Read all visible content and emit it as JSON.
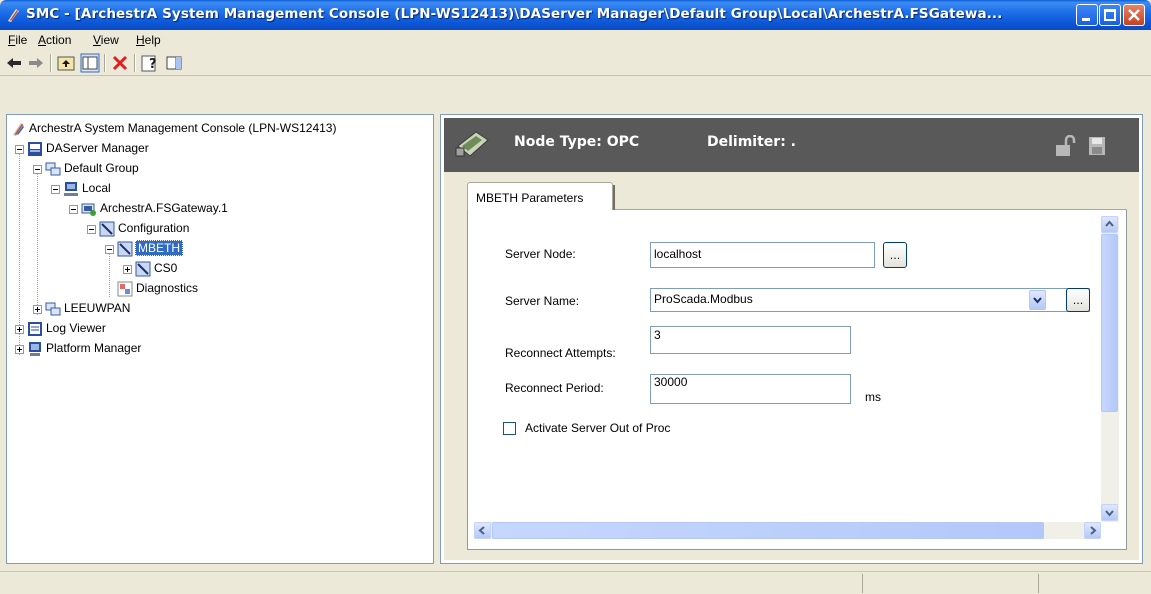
{
  "window": {
    "title": "SMC - [ArchestrA System Management Console (LPN-WS12413)\\DAServer Manager\\Default Group\\Local\\ArchestrA.FSGatewa..."
  },
  "menu": {
    "items": [
      {
        "key": "F",
        "rest": "ile"
      },
      {
        "key": "A",
        "rest": "ction"
      },
      {
        "key": "V",
        "rest": "iew"
      },
      {
        "key": "H",
        "rest": "elp"
      }
    ]
  },
  "toolbar": {
    "icons": [
      "back-arrow-icon",
      "forward-arrow-icon",
      "up-folder-icon",
      "show-hide-tree-icon",
      "delete-icon",
      "properties-icon",
      "show-hide-action-pane-icon"
    ]
  },
  "tree": {
    "root": "ArchestrA System Management Console (LPN-WS12413)",
    "daserver_manager": "DAServer Manager",
    "default_group": "Default Group",
    "local": "Local",
    "fsgateway": "ArchestrA.FSGateway.1",
    "configuration": "Configuration",
    "mbeth": "MBETH",
    "cs0": "CS0",
    "diagnostics": "Diagnostics",
    "leeuwpan": "LEEUWPAN",
    "log_viewer": "Log Viewer",
    "platform_manager": "Platform Manager"
  },
  "details": {
    "node_type": "Node Type: OPC",
    "delimiter": "Delimiter: .",
    "tab_label": "MBETH Parameters",
    "server_node": {
      "label": "Server Node:",
      "value": "localhost"
    },
    "server_name": {
      "label": "Server Name:",
      "value": "ProScada.Modbus"
    },
    "reconnect_attempts": {
      "label": "Reconnect Attempts:",
      "value": "3"
    },
    "reconnect_period": {
      "label": "Reconnect Period:",
      "value": "30000",
      "unit": "ms"
    },
    "activate_out_of_proc": {
      "label": "Activate Server Out of Proc",
      "checked": false
    },
    "ellipsis": "..."
  },
  "colors": {
    "title_bar": "#0b54d3",
    "selection": "#316ac5",
    "header_band": "#595959"
  }
}
